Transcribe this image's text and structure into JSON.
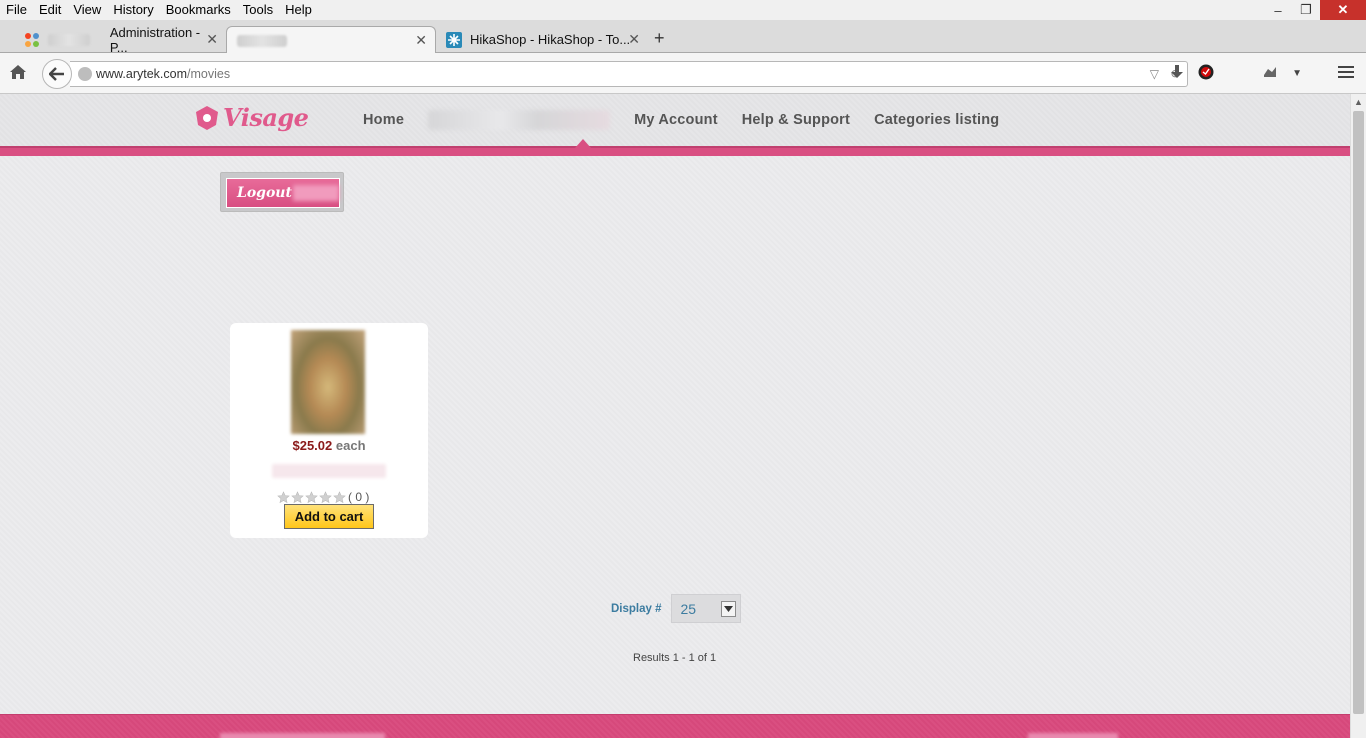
{
  "menubar": {
    "items": [
      "File",
      "Edit",
      "View",
      "History",
      "Bookmarks",
      "Tools",
      "Help"
    ]
  },
  "tabs": [
    {
      "label": "Administration - P...",
      "icon": "joomla-icon"
    },
    {
      "label": "",
      "icon": "blank-icon"
    },
    {
      "label": "HikaShop - HikaShop - To...",
      "icon": "hikashop-icon"
    }
  ],
  "urlbar": {
    "domain": "www.arytek.com",
    "path": "/movies"
  },
  "site": {
    "logo_text": "Visage",
    "nav": [
      "Home",
      "My Account",
      "Help & Support",
      "Categories listing"
    ],
    "logout_label": "Logout"
  },
  "product": {
    "price": "$25.02",
    "price_unit": "each",
    "rating_count": "( 0 )",
    "rating_value": 0,
    "rating_max": 5,
    "add_to_cart": "Add to cart"
  },
  "pagination": {
    "display_label": "Display #",
    "display_value": "25",
    "results_text": "Results 1 - 1 of 1"
  },
  "colors": {
    "brand_pink": "#d94f82",
    "price_red": "#8b1a1a",
    "link_blue": "#3c7ca0",
    "cart_yellow": "#ffc61a"
  }
}
